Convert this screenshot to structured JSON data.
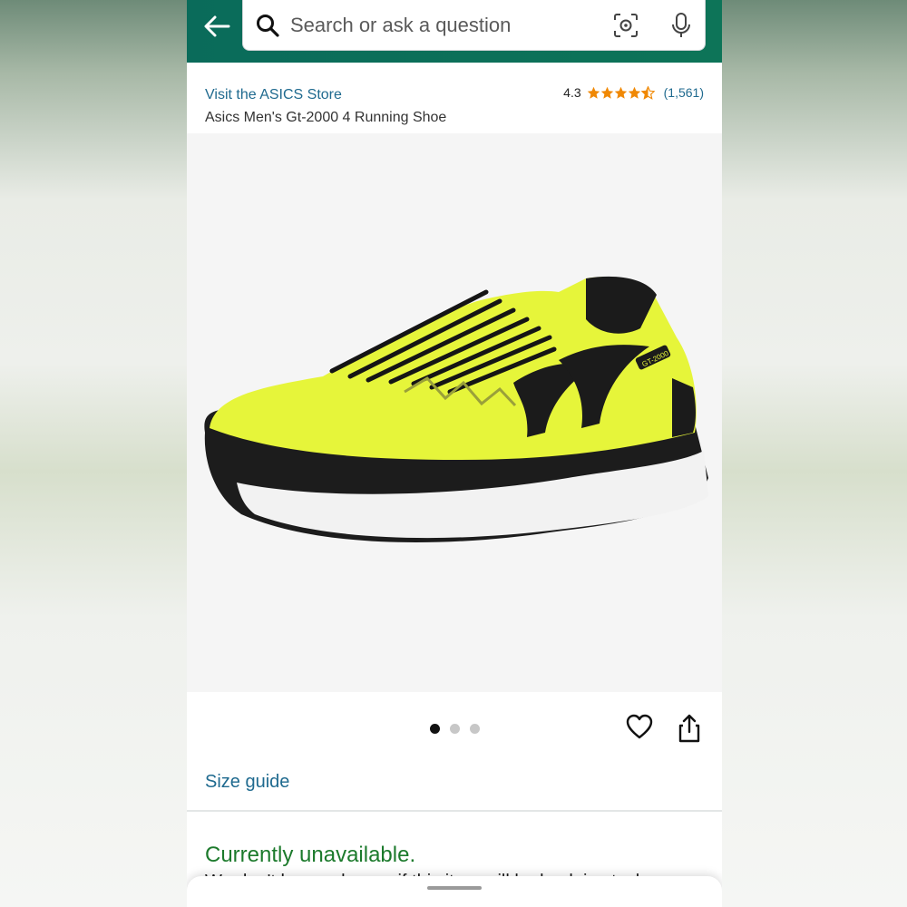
{
  "search": {
    "placeholder": "Search or ask a question"
  },
  "header": {
    "store_link": "Visit the ASICS Store",
    "product_title": "Asics Men's Gt-2000 4 Running Shoe",
    "rating": "4.3",
    "rating_value": 4.3,
    "review_count": "(1,561)"
  },
  "gallery": {
    "image_count": 3,
    "active_index": 0,
    "image_logo_text": "GT-2000"
  },
  "size_guide": "Size guide",
  "availability": {
    "status": "Currently unavailable.",
    "note_partial": "We don't know when or if this item will be back in stock."
  },
  "colors": {
    "topbar": "#0a6b5a",
    "link": "#1f6a8f",
    "unavailable": "#1c7a2c",
    "star": "#f08804",
    "shoe": "#e6f53a"
  },
  "icons": [
    "back-arrow-icon",
    "search-icon",
    "camera-lens-icon",
    "microphone-icon",
    "star-icon",
    "heart-icon",
    "share-icon"
  ]
}
